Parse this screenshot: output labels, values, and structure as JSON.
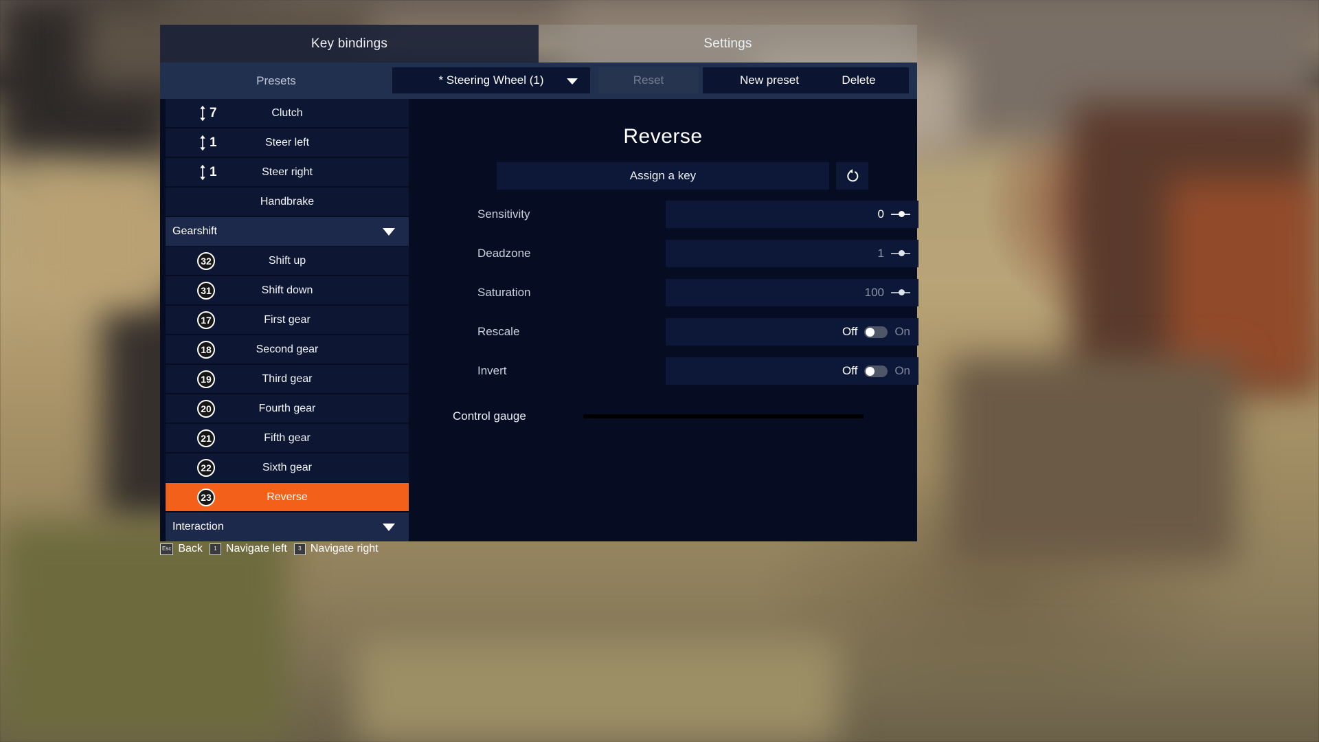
{
  "tabs": [
    {
      "label": "Key bindings",
      "active": true
    },
    {
      "label": "Settings",
      "active": false
    }
  ],
  "presets": {
    "label": "Presets",
    "selected": "* Steering Wheel (1)",
    "reset_label": "Reset",
    "new_preset_label": "New preset",
    "delete_label": "Delete"
  },
  "bindings": [
    {
      "type": "row",
      "badge": "7",
      "badge_kind": "axis",
      "label": "Clutch",
      "selected": false
    },
    {
      "type": "row",
      "badge": "1",
      "badge_kind": "axis",
      "label": "Steer left",
      "selected": false
    },
    {
      "type": "row",
      "badge": "1",
      "badge_kind": "axis",
      "label": "Steer right",
      "selected": false
    },
    {
      "type": "row",
      "badge": "",
      "badge_kind": "none",
      "label": "Handbrake",
      "selected": false
    },
    {
      "type": "section",
      "label": "Gearshift"
    },
    {
      "type": "row",
      "badge": "32",
      "badge_kind": "circle",
      "label": "Shift up",
      "selected": false
    },
    {
      "type": "row",
      "badge": "31",
      "badge_kind": "circle",
      "label": "Shift down",
      "selected": false
    },
    {
      "type": "row",
      "badge": "17",
      "badge_kind": "circle",
      "label": "First gear",
      "selected": false
    },
    {
      "type": "row",
      "badge": "18",
      "badge_kind": "circle",
      "label": "Second gear",
      "selected": false
    },
    {
      "type": "row",
      "badge": "19",
      "badge_kind": "circle",
      "label": "Third gear",
      "selected": false
    },
    {
      "type": "row",
      "badge": "20",
      "badge_kind": "circle",
      "label": "Fourth gear",
      "selected": false
    },
    {
      "type": "row",
      "badge": "21",
      "badge_kind": "circle",
      "label": "Fifth gear",
      "selected": false
    },
    {
      "type": "row",
      "badge": "22",
      "badge_kind": "circle",
      "label": "Sixth gear",
      "selected": false
    },
    {
      "type": "row",
      "badge": "23",
      "badge_kind": "circle",
      "label": "Reverse",
      "selected": true
    },
    {
      "type": "section",
      "label": "Interaction"
    }
  ],
  "detail": {
    "title": "Reverse",
    "assign_label": "Assign a key",
    "reset_icon": "reset-arrow-icon",
    "settings": [
      {
        "name": "Sensitivity",
        "value": "0",
        "kind": "slider",
        "dim": false
      },
      {
        "name": "Deadzone",
        "value": "1",
        "kind": "slider",
        "dim": true
      },
      {
        "name": "Saturation",
        "value": "100",
        "kind": "slider",
        "dim": true
      },
      {
        "name": "Rescale",
        "off_label": "Off",
        "on_label": "On",
        "kind": "toggle",
        "state": "off"
      },
      {
        "name": "Invert",
        "off_label": "Off",
        "on_label": "On",
        "kind": "toggle",
        "state": "off"
      }
    ],
    "gauge_label": "Control gauge"
  },
  "hints": [
    {
      "key": "Esc",
      "label": "Back"
    },
    {
      "key": "1",
      "label": "Navigate left"
    },
    {
      "key": "3",
      "label": "Navigate right"
    }
  ],
  "colors": {
    "accent": "#f2601a",
    "panel": "#060d22",
    "row": "#0d1733",
    "section": "#1d294a",
    "presetbar": "#22304f"
  }
}
